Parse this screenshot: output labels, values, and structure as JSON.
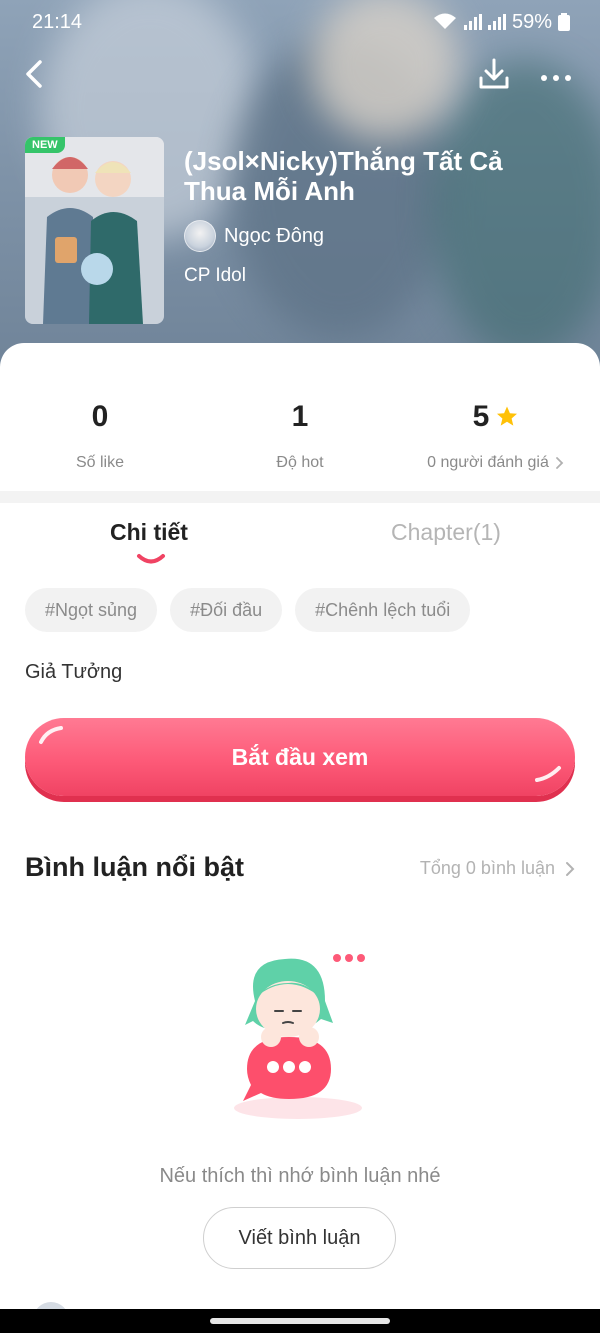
{
  "status_bar": {
    "time": "21:14",
    "battery": "59%"
  },
  "book": {
    "badge": "NEW",
    "title": "(Jsol×Nicky)Thắng Tất Cả Thua Mỗi Anh",
    "author": "Ngọc Đông",
    "category": "CP Idol",
    "genre": "Giả Tưởng"
  },
  "stats": {
    "likes": {
      "value": "0",
      "label": "Số like"
    },
    "hot": {
      "value": "1",
      "label": "Độ hot"
    },
    "rating": {
      "value": "5",
      "label": "0 người đánh giá"
    }
  },
  "tabs": {
    "detail": "Chi tiết",
    "chapter": "Chapter(1)"
  },
  "tags": [
    "#Ngọt sủng",
    "#Đối đầu",
    "#Chênh lệch tuổi"
  ],
  "start_button": "Bắt đầu xem",
  "comments": {
    "title": "Bình luận nổi bật",
    "total": "Tổng 0 bình luận",
    "empty_text": "Nếu thích thì nhớ bình luận nhé",
    "write_button": "Viết bình luận"
  },
  "colors": {
    "accent": "#fd5a78",
    "star": "#ffc107",
    "new_badge": "#35c46a"
  },
  "icons": {
    "back": "back-arrow-icon",
    "download": "download-icon",
    "more": "more-dots-icon",
    "star": "star-icon",
    "chevron": "chevron-right-icon"
  }
}
